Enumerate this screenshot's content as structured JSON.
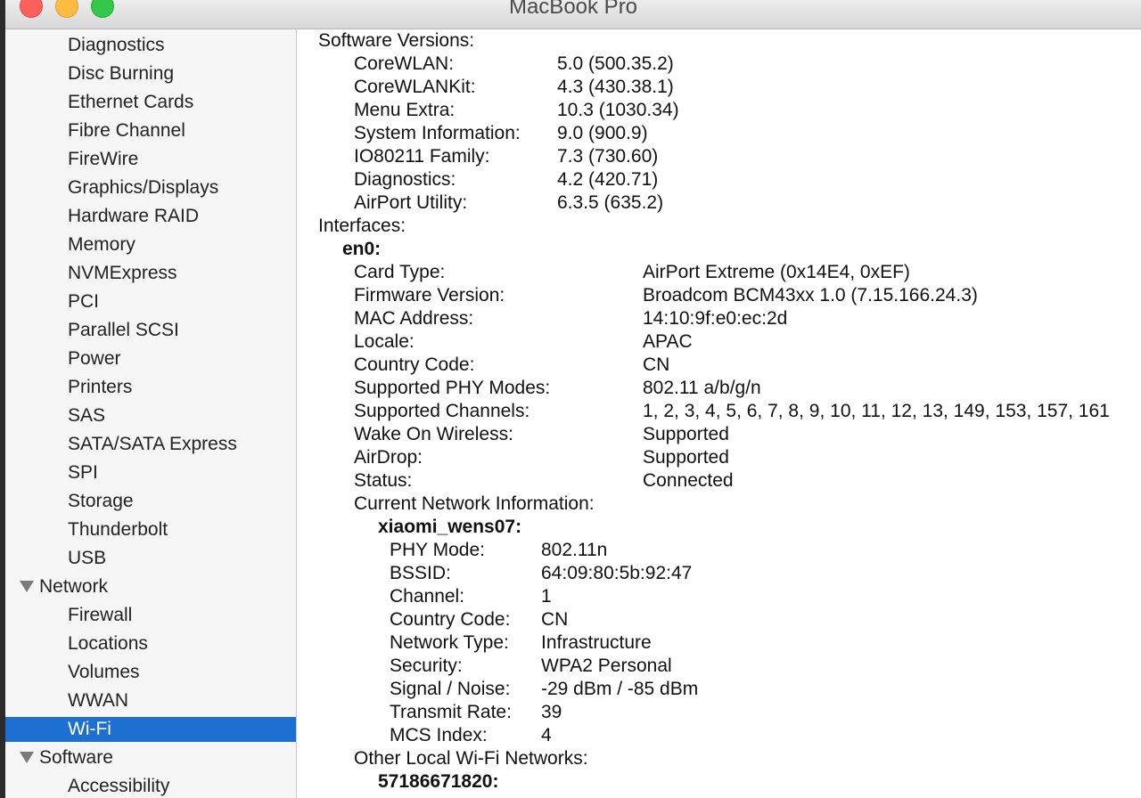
{
  "window": {
    "title": "MacBook Pro"
  },
  "sidebar": {
    "items": [
      {
        "label": "Diagnostics",
        "type": "item"
      },
      {
        "label": "Disc Burning",
        "type": "item"
      },
      {
        "label": "Ethernet Cards",
        "type": "item"
      },
      {
        "label": "Fibre Channel",
        "type": "item"
      },
      {
        "label": "FireWire",
        "type": "item"
      },
      {
        "label": "Graphics/Displays",
        "type": "item"
      },
      {
        "label": "Hardware RAID",
        "type": "item"
      },
      {
        "label": "Memory",
        "type": "item"
      },
      {
        "label": "NVMExpress",
        "type": "item"
      },
      {
        "label": "PCI",
        "type": "item"
      },
      {
        "label": "Parallel SCSI",
        "type": "item"
      },
      {
        "label": "Power",
        "type": "item"
      },
      {
        "label": "Printers",
        "type": "item"
      },
      {
        "label": "SAS",
        "type": "item"
      },
      {
        "label": "SATA/SATA Express",
        "type": "item"
      },
      {
        "label": "SPI",
        "type": "item"
      },
      {
        "label": "Storage",
        "type": "item"
      },
      {
        "label": "Thunderbolt",
        "type": "item"
      },
      {
        "label": "USB",
        "type": "item"
      },
      {
        "label": "Network",
        "type": "section"
      },
      {
        "label": "Firewall",
        "type": "item"
      },
      {
        "label": "Locations",
        "type": "item"
      },
      {
        "label": "Volumes",
        "type": "item"
      },
      {
        "label": "WWAN",
        "type": "item"
      },
      {
        "label": "Wi-Fi",
        "type": "item",
        "selected": true
      },
      {
        "label": "Software",
        "type": "section"
      },
      {
        "label": "Accessibility",
        "type": "item"
      }
    ]
  },
  "content": {
    "software_versions": {
      "heading": "Software Versions:",
      "rows": [
        {
          "key": "CoreWLAN:",
          "value": "5.0 (500.35.2)"
        },
        {
          "key": "CoreWLANKit:",
          "value": "4.3 (430.38.1)"
        },
        {
          "key": "Menu Extra:",
          "value": "10.3 (1030.34)"
        },
        {
          "key": "System Information:",
          "value": "9.0 (900.9)"
        },
        {
          "key": "IO80211 Family:",
          "value": "7.3 (730.60)"
        },
        {
          "key": "Diagnostics:",
          "value": "4.2 (420.71)"
        },
        {
          "key": "AirPort Utility:",
          "value": "6.3.5 (635.2)"
        }
      ]
    },
    "interfaces": {
      "heading": "Interfaces:",
      "name": "en0:",
      "rows": [
        {
          "key": "Card Type:",
          "value": "AirPort Extreme  (0x14E4, 0xEF)"
        },
        {
          "key": "Firmware Version:",
          "value": "Broadcom BCM43xx 1.0 (7.15.166.24.3)"
        },
        {
          "key": "MAC Address:",
          "value": "14:10:9f:e0:ec:2d"
        },
        {
          "key": "Locale:",
          "value": "APAC"
        },
        {
          "key": "Country Code:",
          "value": "CN"
        },
        {
          "key": "Supported PHY Modes:",
          "value": "802.11 a/b/g/n"
        },
        {
          "key": "Supported Channels:",
          "value": "1, 2, 3, 4, 5, 6, 7, 8, 9, 10, 11, 12, 13, 149, 153, 157, 161"
        },
        {
          "key": "Wake On Wireless:",
          "value": "Supported"
        },
        {
          "key": "AirDrop:",
          "value": "Supported"
        },
        {
          "key": "Status:",
          "value": "Connected"
        }
      ],
      "current_network": {
        "heading": "Current Network Information:",
        "name": "xiaomi_wens07:",
        "rows": [
          {
            "key": "PHY Mode:",
            "value": "802.11n"
          },
          {
            "key": "BSSID:",
            "value": "64:09:80:5b:92:47"
          },
          {
            "key": "Channel:",
            "value": "1"
          },
          {
            "key": "Country Code:",
            "value": "CN"
          },
          {
            "key": "Network Type:",
            "value": "Infrastructure"
          },
          {
            "key": "Security:",
            "value": "WPA2 Personal"
          },
          {
            "key": "Signal / Noise:",
            "value": "-29 dBm / -85 dBm"
          },
          {
            "key": "Transmit Rate:",
            "value": "39"
          },
          {
            "key": "MCS Index:",
            "value": "4"
          }
        ]
      },
      "other_networks": {
        "heading": "Other Local Wi-Fi Networks:",
        "name": "57186671820:"
      }
    }
  }
}
